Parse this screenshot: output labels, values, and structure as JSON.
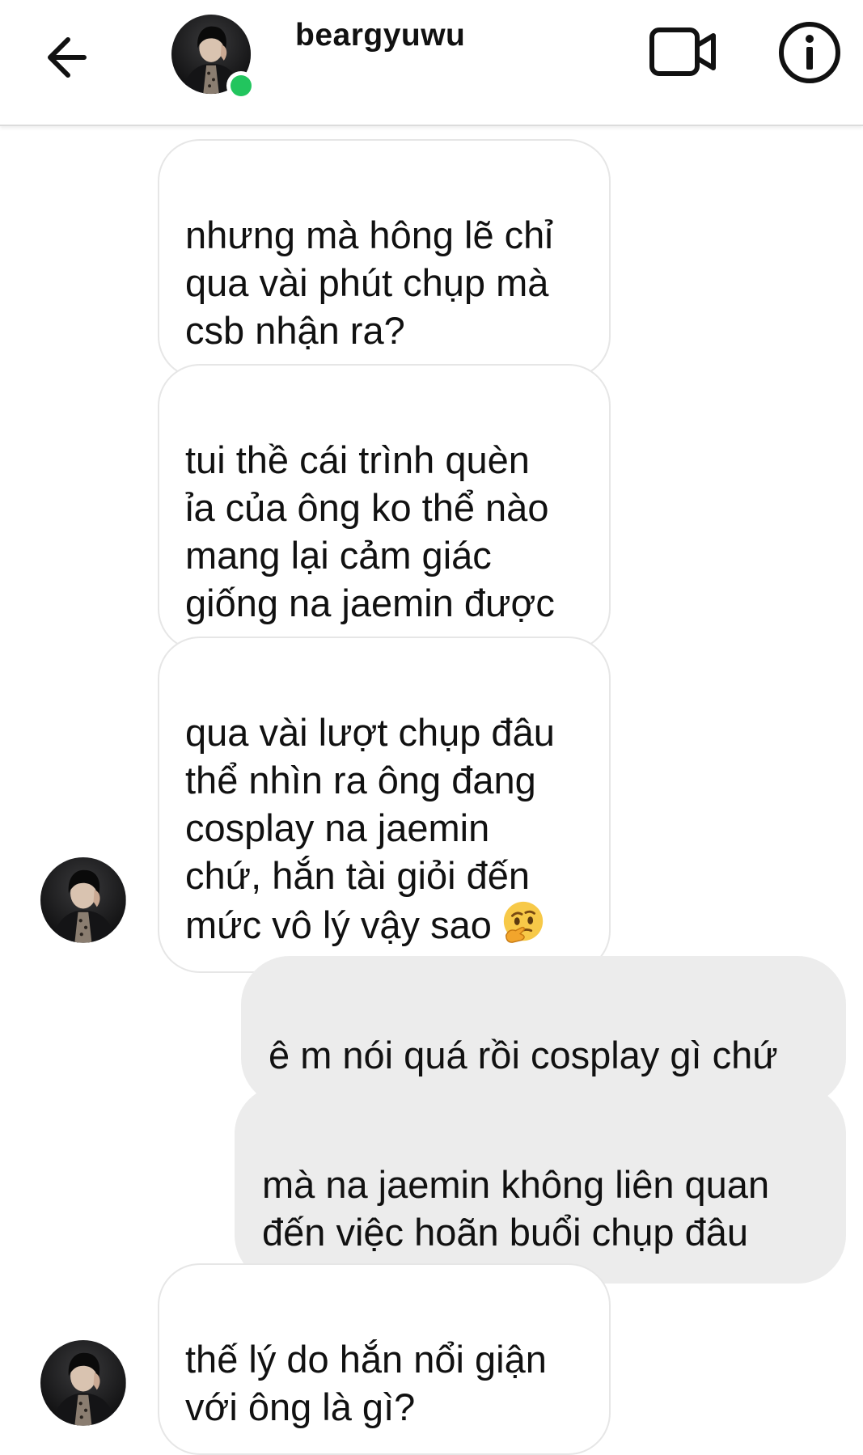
{
  "header": {
    "username": "beargyuwu",
    "online": true,
    "colors": {
      "online_dot": "#22c55e"
    },
    "icons": [
      "back-arrow-icon",
      "video-call-icon",
      "info-icon"
    ]
  },
  "messages": [
    {
      "direction": "incoming",
      "text": "nhưng mà hông lẽ chỉ\nqua vài phút chụp mà\ncsb nhận ra?"
    },
    {
      "direction": "incoming",
      "text": "tui thề cái trình quèn\nỉa của ông ko thể nào\nmang lại cảm giác\ngiống na jaemin được"
    },
    {
      "direction": "incoming",
      "text": "qua vài lượt chụp đâu\nthể nhìn ra ông đang\ncosplay na jaemin\nchứ, hắn tài giỏi đến\nmức vô lý vậy sao",
      "emoji": "thinking-face"
    },
    {
      "direction": "outgoing",
      "text": "ê m nói quá rồi cosplay gì chứ"
    },
    {
      "direction": "outgoing",
      "text": "mà na jaemin không liên quan\nđến việc hoãn buổi chụp đâu"
    },
    {
      "direction": "incoming",
      "text": "thế lý do hắn nổi giận\nvới ông là gì?"
    }
  ]
}
